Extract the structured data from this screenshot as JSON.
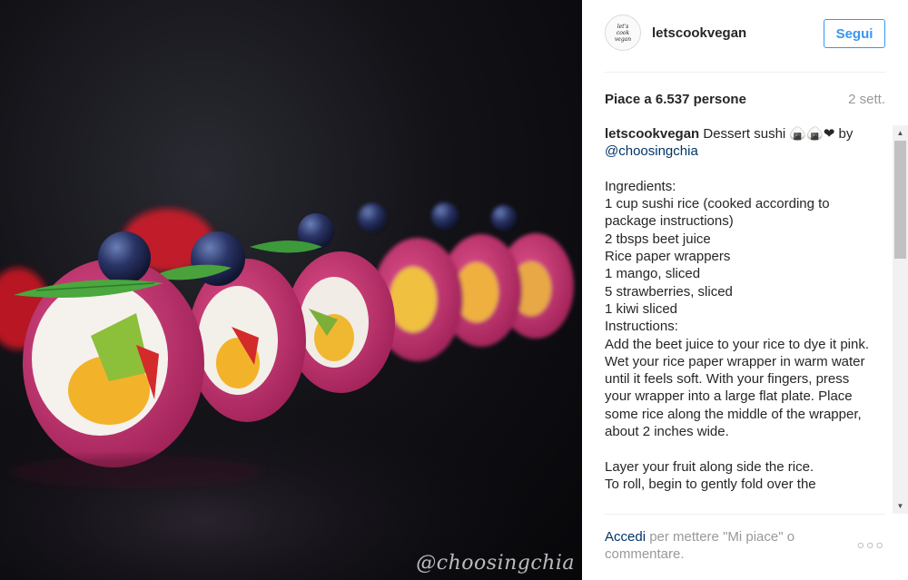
{
  "photo": {
    "watermark": "@choosingchia",
    "description_icon": "photo-dessert-sushi"
  },
  "header": {
    "avatar_text_1": "let's",
    "avatar_text_2": "cook",
    "avatar_text_3": "vegan",
    "username": "letscookvegan",
    "follow_label": "Segui"
  },
  "stats": {
    "likes": "Piace a 6.537 persone",
    "time": "2 sett."
  },
  "caption": {
    "username": "letscookvegan",
    "title": " Dessert sushi 🍙🍙❤ by ",
    "mention": "@choosingchia",
    "body": "\n\nIngredients:\n1 cup sushi rice (cooked according to package instructions)\n2 tbsps beet juice\nRice paper wrappers\n1 mango, sliced\n5 strawberries, sliced\n1 kiwi sliced\nInstructions:\nAdd the beet juice to your rice to dye it pink.\nWet your rice paper wrapper in warm water until it feels soft. With your fingers, press your wrapper into a large flat plate. Place some rice along the middle of the wrapper, about 2 inches wide.\n\nLayer your fruit along side the rice.\nTo roll, begin to gently fold over the"
  },
  "scrollbar": {
    "up_icon": "triangle-up-icon",
    "down_icon": "triangle-down-icon"
  },
  "footer": {
    "login_label": "Accedi",
    "text": " per mettere \"Mi piace\" o commentare.",
    "more_icon": "ellipsis-icon",
    "more_label": "○○○"
  },
  "colors": {
    "accent": "#3897f0",
    "link": "#003569",
    "muted": "#999999",
    "text": "#262626"
  }
}
